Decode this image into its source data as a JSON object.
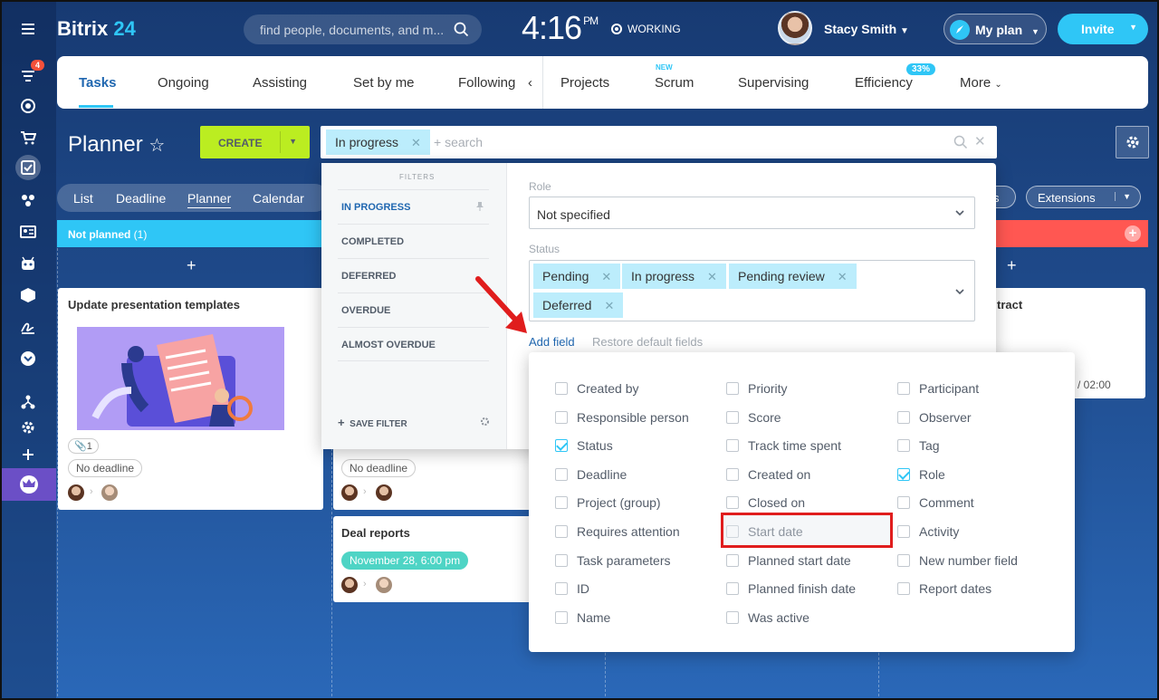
{
  "header": {
    "logo_main": "Bitrix",
    "logo_num": "24",
    "search_placeholder": "find people, documents, and m...",
    "clock_time": "4:16",
    "clock_ampm": "PM",
    "working_label": "WORKING",
    "user_name": "Stacy Smith",
    "myplan_label": "My plan",
    "invite_label": "Invite"
  },
  "sidebar": {
    "notification_count": "4"
  },
  "tabs": {
    "items": [
      "Tasks",
      "Ongoing",
      "Assisting",
      "Set by me",
      "Following",
      "Projects",
      "Scrum",
      "Supervising",
      "Efficiency",
      "More"
    ],
    "scrum_badge": "NEW",
    "efficiency_badge": "33%"
  },
  "planner": {
    "title": "Planner",
    "create_label": "CREATE",
    "active_chip": "In progress",
    "search_placeholder": "+ search",
    "views": [
      "List",
      "Deadline",
      "Planner",
      "Calendar"
    ],
    "extensions_label": "Extensions",
    "extensions_left_partial": "s"
  },
  "columns": {
    "not_planned_label": "Not planned",
    "not_planned_count": "(1)",
    "plus": "+"
  },
  "cards": {
    "card1_title": "Update presentation templates",
    "card1_files": "1",
    "card1_deadline": "No deadline",
    "card2_deadline": "No deadline",
    "card3_title": "Deal reports",
    "card3_deadline": "November 28, 6:00 pm",
    "card4_title_partial": "tract",
    "card4_time": "/ 02:00"
  },
  "filter_popup": {
    "filters_heading": "FILTERS",
    "items": [
      "IN PROGRESS",
      "COMPLETED",
      "DEFERRED",
      "OVERDUE",
      "ALMOST OVERDUE"
    ],
    "save_filter": "SAVE FILTER",
    "role_label": "Role",
    "role_value": "Not specified",
    "status_label": "Status",
    "status_chips": [
      "Pending",
      "In progress",
      "Pending review",
      "Deferred"
    ],
    "add_field": "Add field",
    "restore_fields": "Restore default fields"
  },
  "add_field_popup": {
    "col1": [
      "Created by",
      "Responsible person",
      "Status",
      "Deadline",
      "Project (group)",
      "Requires attention",
      "Task parameters",
      "ID",
      "Name"
    ],
    "col2": [
      "Priority",
      "Score",
      "Track time spent",
      "Created on",
      "Closed on",
      "Start date",
      "Planned start date",
      "Planned finish date",
      "Was active"
    ],
    "col3": [
      "Participant",
      "Observer",
      "Tag",
      "Role",
      "Comment",
      "Activity",
      "New number field",
      "Report dates"
    ],
    "checked": [
      "Status",
      "Role"
    ]
  },
  "colors": {
    "accent": "#2fc6f6",
    "create_green": "#bbed21",
    "link_blue": "#2067b0",
    "highlight_red": "#e01d1d",
    "column_blue": "#2fc6f6",
    "column_red": "#ff5752"
  }
}
